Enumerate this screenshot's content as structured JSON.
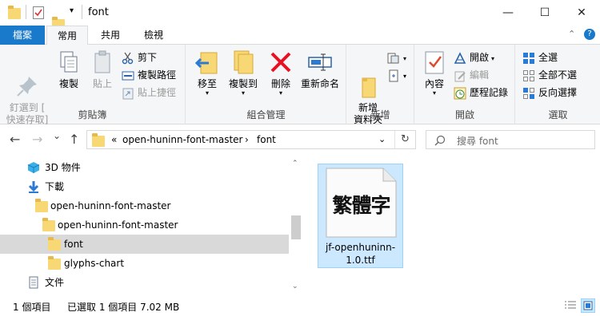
{
  "window": {
    "title": "font",
    "minimize": "—",
    "maximize": "☐",
    "close": "✕"
  },
  "tabs": {
    "file": "檔案",
    "home": "常用",
    "share": "共用",
    "view": "檢視",
    "collapse": "⌃",
    "help": "?"
  },
  "ribbon": {
    "clipboard": {
      "label": "剪貼簿",
      "pin": "釘選到 [\n快速存取]",
      "copy": "複製",
      "paste": "貼上",
      "cut": "剪下",
      "copy_path": "複製路徑",
      "paste_shortcut": "貼上捷徑"
    },
    "organize": {
      "label": "組合管理",
      "move_to": "移至",
      "copy_to": "複製到",
      "delete": "刪除",
      "rename": "重新命名"
    },
    "new": {
      "label": "新增",
      "new_folder": "新增\n資料夾"
    },
    "open": {
      "label": "開啟",
      "properties": "內容",
      "open": "開啟",
      "edit": "編輯",
      "history": "歷程記錄"
    },
    "select": {
      "label": "選取",
      "select_all": "全選",
      "select_none": "全部不選",
      "invert": "反向選擇"
    }
  },
  "nav": {
    "back": "←",
    "forward": "→",
    "recent": "⌄",
    "up": "↑",
    "crumb_overflow": "«",
    "crumb_1": "open-huninn-font-master",
    "crumb_sep": "›",
    "crumb_2": "font",
    "refresh": "↻",
    "search_placeholder": "搜尋 font"
  },
  "tree": [
    {
      "label": "3D 物件"
    },
    {
      "label": "下載"
    },
    {
      "label": "open-huninn-font-master"
    },
    {
      "label": "open-huninn-font-master"
    },
    {
      "label": "font"
    },
    {
      "label": "glyphs-chart"
    },
    {
      "label": "文件"
    }
  ],
  "files": [
    {
      "name": "jf-openhuninn-1.0.ttf",
      "thumb_text": "繁體字"
    }
  ],
  "status": {
    "count": "1 個項目",
    "selected": "已選取 1 個項目 7.02 MB"
  },
  "colors": {
    "accent": "#1979ca",
    "folder": "#f8d775",
    "selection": "#cce8ff",
    "delete_red": "#e81123"
  }
}
